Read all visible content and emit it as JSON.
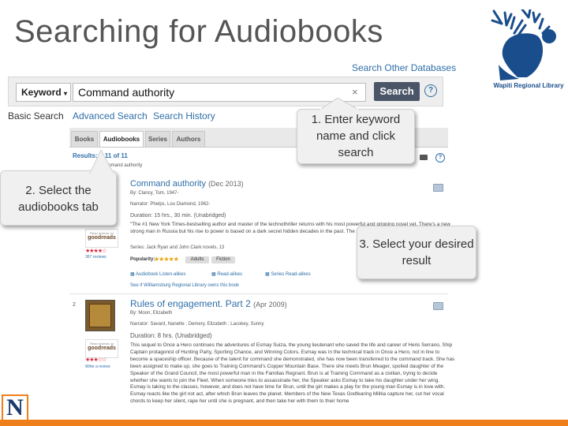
{
  "slide": {
    "title": "Searching for Audiobooks"
  },
  "logo": {
    "text": "Wapiti Regional Library"
  },
  "search": {
    "other_databases": "Search Other Databases",
    "type_label": "Keyword",
    "query": "Command authority",
    "clear": "×",
    "button": "Search",
    "help": "?"
  },
  "subnav": [
    "Basic Search",
    "Advanced Search",
    "Search History"
  ],
  "tabs": [
    "Books",
    "Audiobooks",
    "Series",
    "Authors"
  ],
  "results": {
    "count": "Results: 1-11 of 11",
    "query_echo": "Command authority"
  },
  "callouts": {
    "step1": "1. Enter keyword name and click search",
    "step2": "2. Select the audiobooks tab",
    "step3": "3. Select your desired result"
  },
  "result1": {
    "title": "Command authority",
    "date": "(Dec 2013)",
    "author": "By: Clancy, Tom, 1947-",
    "narrator": "Narrator: Phelps, Lou Diamond, 1962-",
    "duration": "Duration: 15 hrs., 30 min. (Unabridged)",
    "description": "\"The #1 New York Times-bestselling author and master of the technothriller returns with his most powerful and gripping novel yet. There's a new strong man in Russia but his rise to power is based on a dark secret hidden decades in the past. The solution to that mystery lies in a story... but he faces his old enemies with his most unexpected source: President Jack Ryan\"--",
    "series": "Series: Jack Ryan and John Clark novels, 13",
    "popularity": "Popularity:",
    "tags": [
      "Adults",
      "Fiction"
    ],
    "links": [
      "Audiobook Listen-alikes",
      "Read-alikes",
      "Series Read-alikes"
    ],
    "also": "See if Williamsburg Regional Library owns this book",
    "reviews": "367 reviews"
  },
  "result2": {
    "number": "2",
    "title": "Rules of engagement. Part 2",
    "date": "(Apr 2009)",
    "author": "By: Moon, Elizabeth",
    "narrator": "Narrator: Savard, Nanette ; Demery, Elizabeth ; Lacokey, Sunny",
    "duration": "Duration: 8 hrs. (Unabridged)",
    "description": "This sequel to Once a Hero continues the adventures of Esmay Suiza, the young lieutenant who saved the life and career of Heris Serrano, Ship Captain protagonist of Hunting Party, Sporting Chance, and Winning Colors. Esmay was in the technical track in Once a Hero, not in line to become a spaceship officer. Because of the talent for command she demonstrated, she has now been transferred to the command track. She has been assigned to make up, she goes to Training Command's Copper Mountain Base. There she meets Brun Meager, spoiled daughter of the Speaker of the Grand Council, the most powerful man in the Familias Regnant. Brun is at Training Command as a civilian, trying to decide whether she wants to join the Fleet. When someone tries to assassinate her, the Speaker asks Esmay to take his daughter under her wing. Esmay is taking to the classes, however, and does not have time for Brun, until the girl makes a play for the young man Esmay is in love with. Esmay reacts like the girl not act, after which Brun leaves the planet. Members of the New Texas Godfearing Militia capture her, cut her vocal chords to keep her silent, rape her until she is pregnant, and then take her with them to their home",
    "review_link": "Write a review"
  },
  "goodreads": {
    "small": "Read reviews on",
    "name": "goodreads"
  },
  "bottom": {
    "n_logo": "N"
  }
}
